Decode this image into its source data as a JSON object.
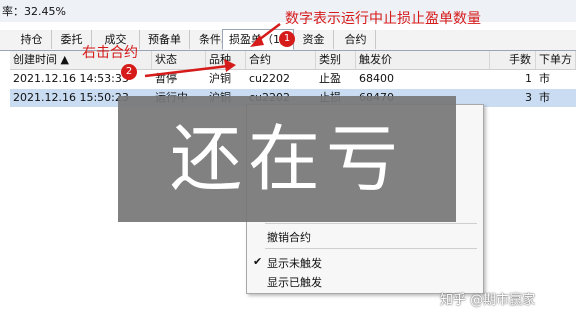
{
  "topbar": {
    "rate_text": "率：32.45%"
  },
  "tabs": [
    {
      "label": "持仓"
    },
    {
      "label": "委托"
    },
    {
      "label": "成交"
    },
    {
      "label": "预备单"
    },
    {
      "label": "条件单"
    },
    {
      "label": "损盈单（1）"
    },
    {
      "label": "资金"
    },
    {
      "label": "合约"
    }
  ],
  "table": {
    "headers": [
      "创建时间 ▲",
      "状态",
      "品种",
      "合约",
      "类别",
      "触发价",
      "手数",
      "下单方"
    ],
    "rows": [
      {
        "time": "2021.12.16 14:53:33",
        "status": "暂停",
        "variety": "沪铜",
        "contract": "cu2202",
        "type": "止盈",
        "price": "68400",
        "qty": "1",
        "dir": "市"
      },
      {
        "time": "2021.12.16 15:50:23",
        "status": "运行中",
        "variety": "沪铜",
        "contract": "cu2202",
        "type": "止损",
        "price": "68470",
        "qty": "3",
        "dir": "市"
      }
    ]
  },
  "annotations": {
    "note1": "数字表示运行中止损止盈单数量",
    "note2": "右击合约",
    "badge1": "1",
    "badge2": "2",
    "colors": {
      "red": "#d61b1b"
    }
  },
  "context_menu": {
    "items": [
      {
        "label": "撤销合约"
      },
      {
        "label": "显示未触发",
        "checked": true
      },
      {
        "label": "显示已触发",
        "checked": false
      }
    ],
    "check_glyph": "✔"
  },
  "overlay": {
    "text": "还在亏"
  },
  "watermark": {
    "text": "知乎 @期市赢家"
  }
}
